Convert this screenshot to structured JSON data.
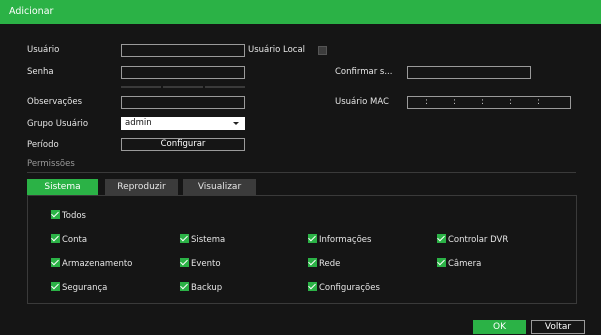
{
  "dialog": {
    "title": "Adicionar"
  },
  "form": {
    "usuario_label": "Usuário",
    "usuario_value": "",
    "usuario_local_label": "Usuário Local",
    "senha_label": "Senha",
    "confirmar_label": "Confirmar s...",
    "observacoes_label": "Observações",
    "usuario_mac_label": "Usuário MAC",
    "mac_separators": [
      ":",
      ":",
      ":",
      ":",
      ":"
    ],
    "grupo_label": "Grupo Usuário",
    "grupo_value": "admin",
    "periodo_label": "Período",
    "configurar_label": "Configurar"
  },
  "permissions": {
    "section_label": "Permissões",
    "tabs": [
      {
        "label": "Sistema",
        "active": true
      },
      {
        "label": "Reproduzir",
        "active": false
      },
      {
        "label": "Visualizar",
        "active": false
      }
    ],
    "all_label": "Todos",
    "items": [
      {
        "label": "Conta",
        "checked": true
      },
      {
        "label": "Sistema",
        "checked": true
      },
      {
        "label": "Informações",
        "checked": true
      },
      {
        "label": "Controlar DVR",
        "checked": true
      },
      {
        "label": "Armazenamento",
        "checked": true
      },
      {
        "label": "Evento",
        "checked": true
      },
      {
        "label": "Rede",
        "checked": true
      },
      {
        "label": "Câmera",
        "checked": true
      },
      {
        "label": "Segurança",
        "checked": true
      },
      {
        "label": "Backup",
        "checked": true
      },
      {
        "label": "Configurações",
        "checked": true
      }
    ]
  },
  "buttons": {
    "ok": "OK",
    "back": "Voltar"
  },
  "colors": {
    "accent": "#2bb246",
    "background": "#151515"
  }
}
